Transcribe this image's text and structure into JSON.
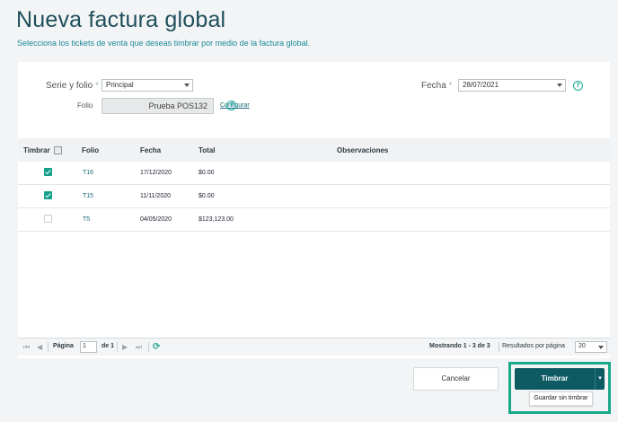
{
  "header": {
    "title": "Nueva factura global",
    "subtitle": "Selecciona los tickets de venta que deseas timbrar por medio de la factura global."
  },
  "form": {
    "serie_label": "Serie y folio",
    "serie_value": "Principal",
    "folio_label": "Folio",
    "folio_value": "Prueba POS132",
    "configurar_link": "Configurar",
    "fecha_label": "Fecha",
    "fecha_value": "28/07/2021",
    "required_mark": "*",
    "help_glyph": "?"
  },
  "table": {
    "columns": [
      "Timbrar",
      "Folio",
      "Fecha",
      "Total",
      "Observaciones"
    ],
    "rows": [
      {
        "checked": true,
        "folio": "T16",
        "fecha": "17/12/2020",
        "total": "$0.00",
        "observaciones": ""
      },
      {
        "checked": true,
        "folio": "T15",
        "fecha": "11/11/2020",
        "total": "$0.00",
        "observaciones": ""
      },
      {
        "checked": false,
        "folio": "T5",
        "fecha": "04/05/2020",
        "total": "$123,123.00",
        "observaciones": ""
      }
    ]
  },
  "pager": {
    "page_label": "Página",
    "page_value": "1",
    "of_label": "de 1",
    "showing": "Mostrando 1 - 3 de 3",
    "per_page_label": "Resultados por página",
    "per_page_value": "20",
    "first_icon": "⏮",
    "prev_icon": "◀",
    "next_icon": "▶",
    "last_icon": "⏭",
    "refresh_icon": "⟳"
  },
  "actions": {
    "cancel_label": "Cancelar",
    "timbrar_label": "Timbrar",
    "split_glyph": "▾",
    "save_no_stamp_label": "Guardar sin timbrar"
  },
  "colors": {
    "accent": "#16a08c",
    "primary_button": "#0d5a63",
    "title": "#1f4f5c"
  }
}
